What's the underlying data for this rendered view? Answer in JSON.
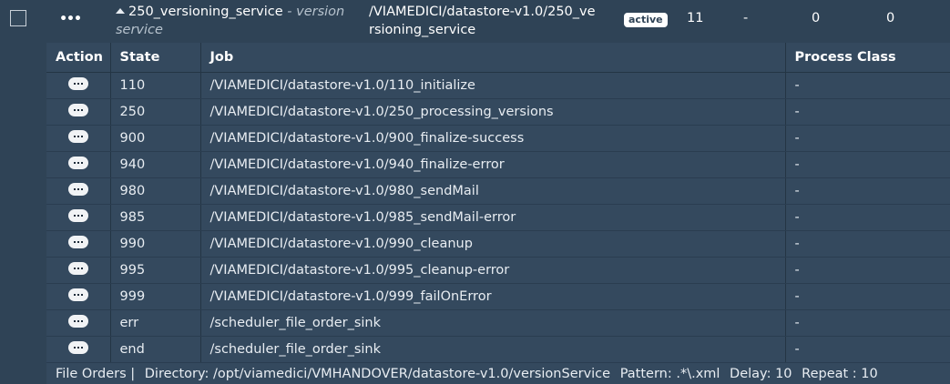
{
  "order": {
    "name": "250_versioning_service",
    "separator": " - ",
    "title": "version service",
    "path": "/VIAMEDICI/datastore-v1.0/250_versioning_service",
    "status": "active",
    "count": "11",
    "dash": "-",
    "num_a": "0",
    "num_b": "0"
  },
  "columns": {
    "action": "Action",
    "state": "State",
    "job": "Job",
    "process_class": "Process Class"
  },
  "rows": [
    {
      "state": "110",
      "job": "/VIAMEDICI/datastore-v1.0/110_initialize",
      "process_class": "-"
    },
    {
      "state": "250",
      "job": "/VIAMEDICI/datastore-v1.0/250_processing_versions",
      "process_class": "-"
    },
    {
      "state": "900",
      "job": "/VIAMEDICI/datastore-v1.0/900_finalize-success",
      "process_class": "-"
    },
    {
      "state": "940",
      "job": "/VIAMEDICI/datastore-v1.0/940_finalize-error",
      "process_class": "-"
    },
    {
      "state": "980",
      "job": "/VIAMEDICI/datastore-v1.0/980_sendMail",
      "process_class": "-"
    },
    {
      "state": "985",
      "job": "/VIAMEDICI/datastore-v1.0/985_sendMail-error",
      "process_class": "-"
    },
    {
      "state": "990",
      "job": "/VIAMEDICI/datastore-v1.0/990_cleanup",
      "process_class": "-"
    },
    {
      "state": "995",
      "job": "/VIAMEDICI/datastore-v1.0/995_cleanup-error",
      "process_class": "-"
    },
    {
      "state": "999",
      "job": "/VIAMEDICI/datastore-v1.0/999_failOnError",
      "process_class": "-"
    },
    {
      "state": "err",
      "job": "/scheduler_file_order_sink",
      "process_class": "-"
    },
    {
      "state": "end",
      "job": "/scheduler_file_order_sink",
      "process_class": "-"
    }
  ],
  "footer": {
    "label": "File Orders |",
    "directory": "Directory: /opt/viamedici/VMHANDOVER/datastore-v1.0/versionService",
    "pattern": "Pattern: .*\\.xml",
    "delay": "Delay: 10",
    "repeat": "Repeat : 10"
  },
  "icons": {
    "row_menu": "ellipsis-icon",
    "expand": "caret-up-icon",
    "action": "ellipsis-pill-icon"
  }
}
